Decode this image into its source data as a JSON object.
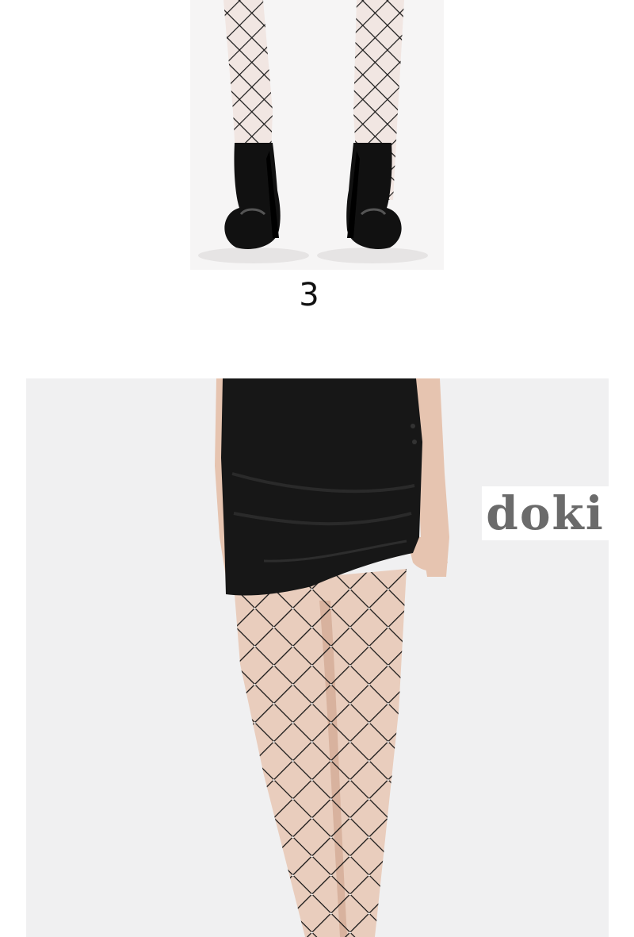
{
  "section": {
    "number": "3"
  },
  "brand": {
    "logo_text": "doki"
  },
  "photos": {
    "top": {
      "subject": "legs-in-fishnet-tights-with-black-patent-heels"
    },
    "bottom": {
      "subject": "model-in-black-mini-skirt-and-rhinestone-fishnet-tights"
    }
  },
  "colors": {
    "background": "#ffffff",
    "photo_bg_top": "#f6f5f5",
    "photo_bg_bottom": "#f0f0f1",
    "fabric": "#141414",
    "skin": "#e8c7b4",
    "logo": "#6b6b6b"
  }
}
